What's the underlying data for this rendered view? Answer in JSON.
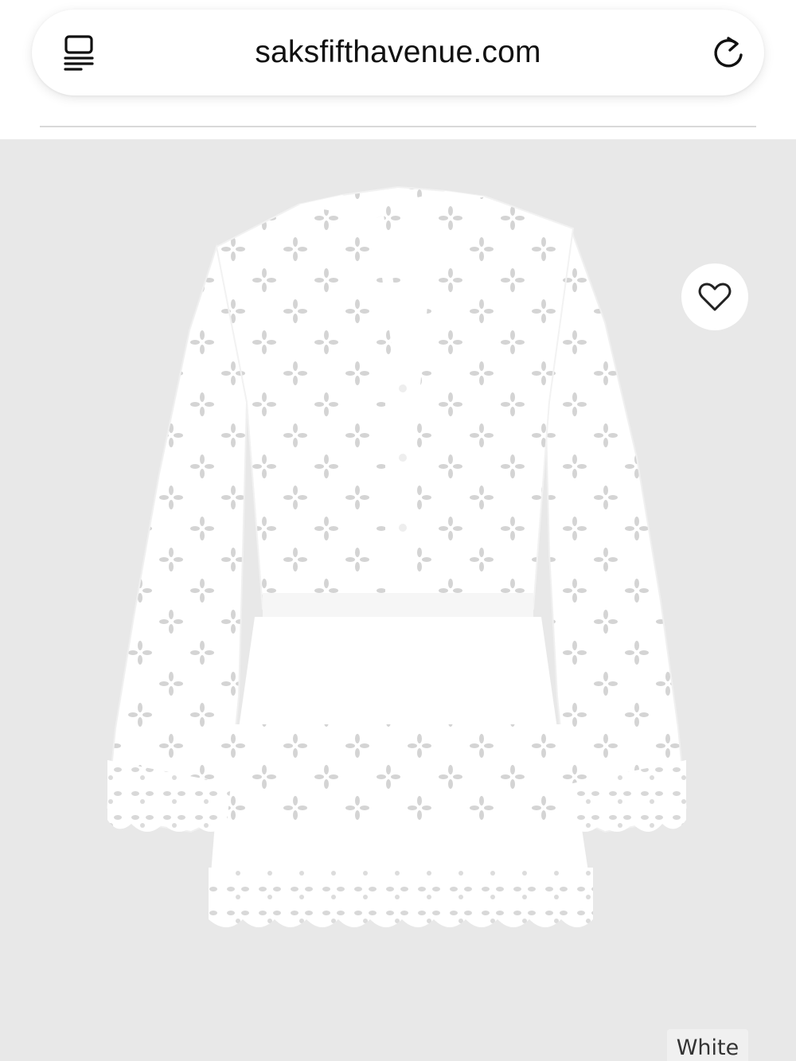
{
  "browser": {
    "url": "saksfifthavenue.com",
    "reader_icon": "reader-mode-icon",
    "reload_icon": "reload-icon"
  },
  "product": {
    "image_alt": "White eyelet tiered mini dress with bell sleeves",
    "wishlist_icon": "heart-icon",
    "color_label": "White"
  },
  "colors": {
    "image_background": "#e8e8e8",
    "garment": "#ffffff"
  }
}
